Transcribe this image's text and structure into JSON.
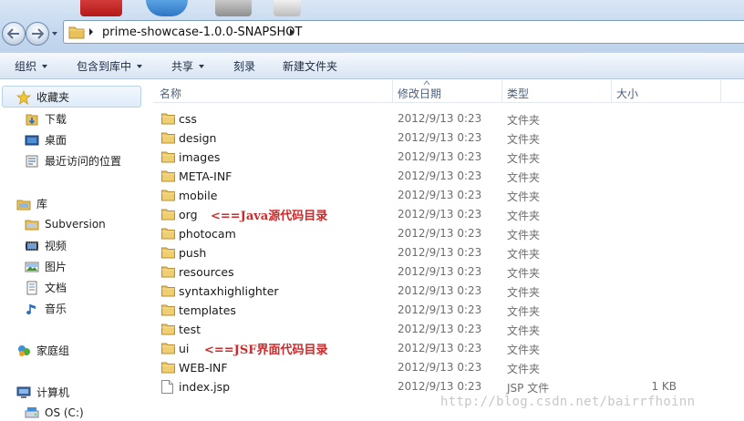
{
  "address": {
    "path": "prime-showcase-1.0.0-SNAPSHOT",
    "icons": [
      "back-arrow-icon",
      "forward-arrow-icon",
      "folder-icon",
      "chevron-right-icon"
    ]
  },
  "toolbar": {
    "organize": "组织",
    "include_in_library": "包含到库中",
    "share": "共享",
    "burn": "刻录",
    "new_folder": "新建文件夹"
  },
  "sidebar": {
    "favorites": {
      "label": "收藏夹",
      "items": [
        {
          "label": "下载",
          "icon": "download-folder-icon"
        },
        {
          "label": "桌面",
          "icon": "desktop-icon"
        },
        {
          "label": "最近访问的位置",
          "icon": "recent-places-icon"
        }
      ]
    },
    "libraries": {
      "label": "库",
      "items": [
        {
          "label": "Subversion",
          "icon": "library-icon"
        },
        {
          "label": "视频",
          "icon": "video-icon"
        },
        {
          "label": "图片",
          "icon": "pictures-icon"
        },
        {
          "label": "文档",
          "icon": "documents-icon"
        },
        {
          "label": "音乐",
          "icon": "music-icon"
        }
      ]
    },
    "homegroup": {
      "label": "家庭组",
      "icon": "homegroup-icon"
    },
    "computer": {
      "label": "计算机",
      "items": [
        {
          "label": "OS (C:)",
          "icon": "drive-icon"
        }
      ]
    }
  },
  "columns": {
    "name": "名称",
    "modified": "修改日期",
    "type": "类型",
    "size": "大小"
  },
  "files": [
    {
      "name": "css",
      "modified": "2012/9/13 0:23",
      "type": "文件夹",
      "size": "",
      "kind": "folder"
    },
    {
      "name": "design",
      "modified": "2012/9/13 0:23",
      "type": "文件夹",
      "size": "",
      "kind": "folder"
    },
    {
      "name": "images",
      "modified": "2012/9/13 0:23",
      "type": "文件夹",
      "size": "",
      "kind": "folder"
    },
    {
      "name": "META-INF",
      "modified": "2012/9/13 0:23",
      "type": "文件夹",
      "size": "",
      "kind": "folder"
    },
    {
      "name": "mobile",
      "modified": "2012/9/13 0:23",
      "type": "文件夹",
      "size": "",
      "kind": "folder"
    },
    {
      "name": "org",
      "modified": "2012/9/13 0:23",
      "type": "文件夹",
      "size": "",
      "kind": "folder",
      "annotation": "<==Java源代码目录"
    },
    {
      "name": "photocam",
      "modified": "2012/9/13 0:23",
      "type": "文件夹",
      "size": "",
      "kind": "folder"
    },
    {
      "name": "push",
      "modified": "2012/9/13 0:23",
      "type": "文件夹",
      "size": "",
      "kind": "folder"
    },
    {
      "name": "resources",
      "modified": "2012/9/13 0:23",
      "type": "文件夹",
      "size": "",
      "kind": "folder"
    },
    {
      "name": "syntaxhighlighter",
      "modified": "2012/9/13 0:23",
      "type": "文件夹",
      "size": "",
      "kind": "folder"
    },
    {
      "name": "templates",
      "modified": "2012/9/13 0:23",
      "type": "文件夹",
      "size": "",
      "kind": "folder"
    },
    {
      "name": "test",
      "modified": "2012/9/13 0:23",
      "type": "文件夹",
      "size": "",
      "kind": "folder"
    },
    {
      "name": "ui",
      "modified": "2012/9/13 0:23",
      "type": "文件夹",
      "size": "",
      "kind": "folder",
      "annotation": "<==JSF界面代码目录"
    },
    {
      "name": "WEB-INF",
      "modified": "2012/9/13 0:23",
      "type": "文件夹",
      "size": "",
      "kind": "folder"
    },
    {
      "name": "index.jsp",
      "modified": "2012/9/13 0:23",
      "type": "JSP 文件",
      "size": "1 KB",
      "kind": "file"
    }
  ],
  "watermark": "http://blog.csdn.net/bairrfhoinn",
  "colors": {
    "annotation": "#cc2a2a",
    "folder": "#e8c15c",
    "header_gradient_top": "#d9e6f5"
  }
}
